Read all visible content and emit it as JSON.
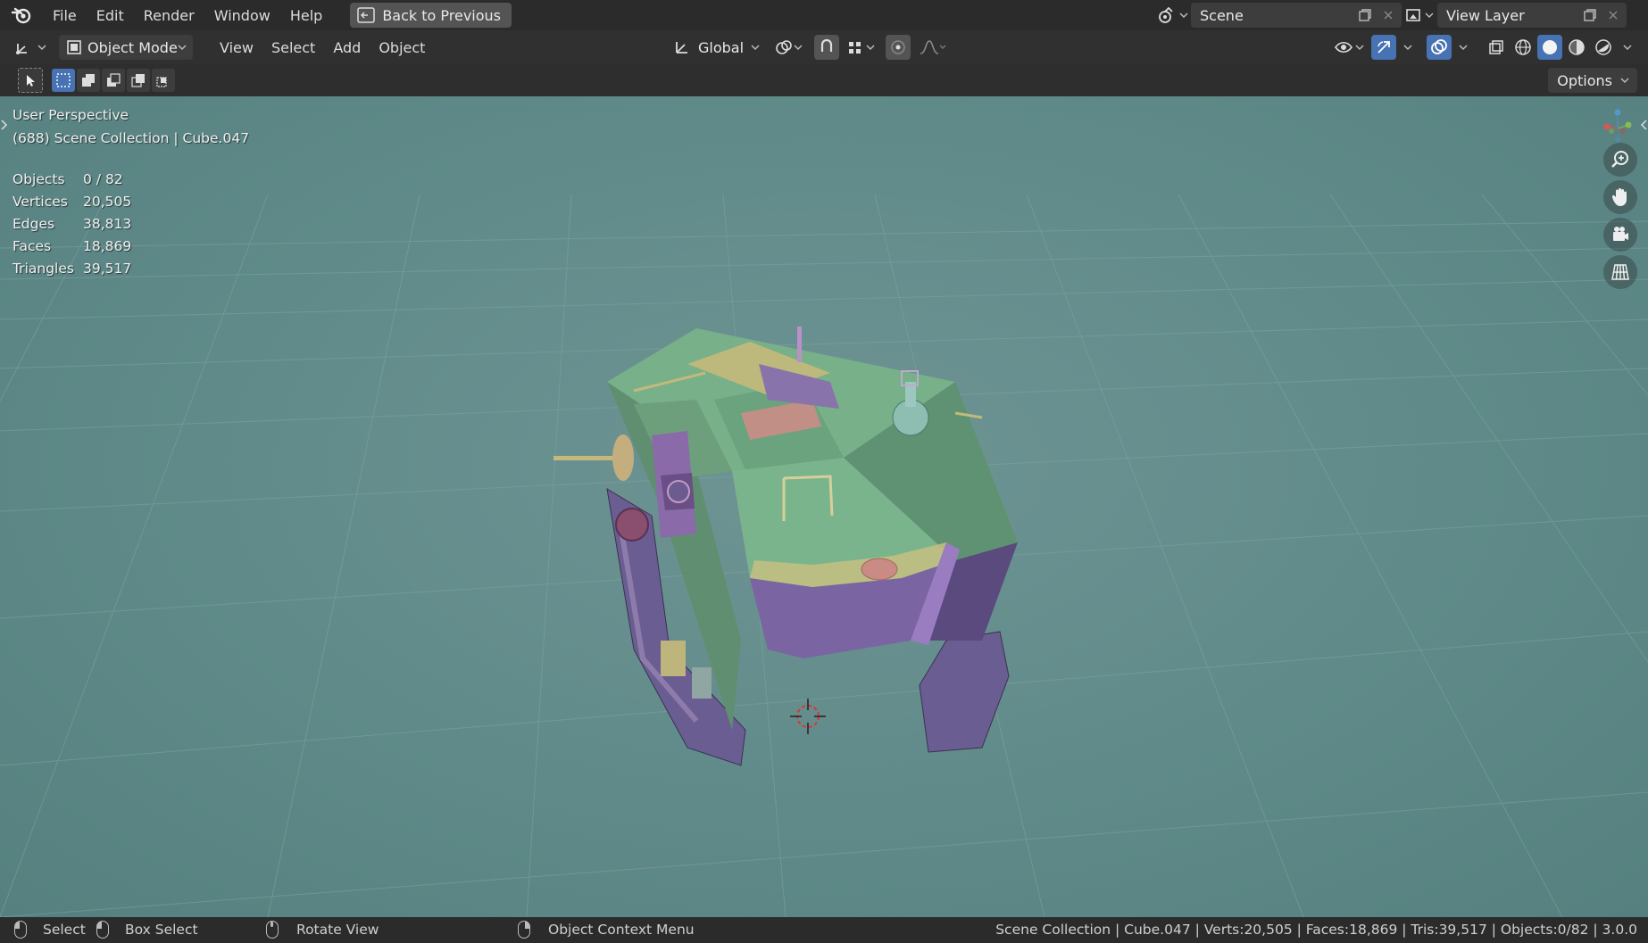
{
  "topbar": {
    "menus": [
      "File",
      "Edit",
      "Render",
      "Window",
      "Help"
    ],
    "back_button": "Back to Previous",
    "scene_name": "Scene",
    "view_layer_name": "View Layer"
  },
  "header": {
    "mode": "Object Mode",
    "menus": [
      "View",
      "Select",
      "Add",
      "Object"
    ],
    "orientation": "Global"
  },
  "toolrow": {
    "options_label": "Options"
  },
  "viewport": {
    "view_name": "User Perspective",
    "collection_info": "(688) Scene Collection | Cube.047",
    "stats": [
      {
        "label": "Objects",
        "value": "0 / 82"
      },
      {
        "label": "Vertices",
        "value": "20,505"
      },
      {
        "label": "Edges",
        "value": "38,813"
      },
      {
        "label": "Faces",
        "value": "18,869"
      },
      {
        "label": "Triangles",
        "value": "39,517"
      }
    ],
    "background_color": "#6a9090",
    "model_body_color": "#6fa37f",
    "model_accent_color": "#8a6aa8",
    "model_trim_color": "#c4b97a"
  },
  "statusbar": {
    "select": "Select",
    "box_select": "Box Select",
    "rotate_view": "Rotate View",
    "context_menu": "Object Context Menu",
    "info": "Scene Collection | Cube.047 | Verts:20,505 | Faces:18,869 | Tris:39,517 | Objects:0/82 | 3.0.0"
  },
  "icons": [
    "blender-logo-icon",
    "back-icon",
    "scene-icon",
    "view-layer-icon",
    "editor-type-icon",
    "object-mode-icon",
    "transform-orientation-icon",
    "pivot-icon",
    "snap-icon",
    "proportional-edit-icon",
    "visibility-icon",
    "gizmo-icon",
    "overlay-icon",
    "xray-icon",
    "wireframe-shading-icon",
    "solid-shading-icon",
    "material-shading-icon",
    "rendered-shading-icon",
    "zoom-icon",
    "pan-hand-icon",
    "camera-icon",
    "grid-view-icon",
    "navigation-gizmo-icon",
    "3d-cursor-icon"
  ]
}
